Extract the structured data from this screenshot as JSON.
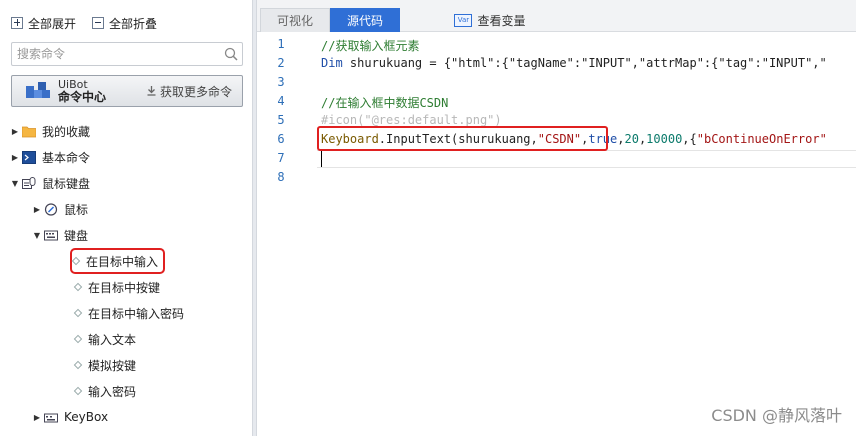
{
  "left_panel": {
    "expand_all": "全部展开",
    "collapse_all": "全部折叠",
    "search_placeholder": "搜索命令",
    "banner": {
      "line1": "UiBot",
      "line2": "命令中心",
      "more": "获取更多命令"
    },
    "tree": {
      "favorites": "我的收藏",
      "basic": "基本命令",
      "mouse_keyboard": "鼠标键盘",
      "mouse": "鼠标",
      "keyboard": "键盘",
      "keyboard_items": [
        "在目标中输入",
        "在目标中按键",
        "在目标中输入密码",
        "输入文本",
        "模拟按键",
        "输入密码"
      ],
      "keybox": "KeyBox"
    }
  },
  "tabs": {
    "visual": "可视化",
    "source": "源代码",
    "vars": "查看变量",
    "vars_icon_text": "Var"
  },
  "editor": {
    "line_numbers": [
      "1",
      "2",
      "3",
      "4",
      "5",
      "6",
      "7",
      "8"
    ],
    "line1": "//获取输入框元素",
    "line2_kw": "Dim",
    "line2_rest": " shurukuang = {\"html\":{\"tagName\":\"INPUT\",\"attrMap\":{\"tag\":\"INPUT\",\"",
    "line4": "//在输入框中数据CSDN",
    "line5": "#icon(\"@res:default.png\")",
    "line6_obj": "Keyboard",
    "line6_a": ".InputText(shurukuang,",
    "line6_str": "\"CSDN\"",
    "line6_b": ",",
    "line6_true": "true",
    "line6_c": ",",
    "line6_n1": "20",
    "line6_d": ",",
    "line6_n2": "10000",
    "line6_e": ",{",
    "line6_str2": "\"bContinueOnError\""
  },
  "watermark": "CSDN @静风落叶"
}
